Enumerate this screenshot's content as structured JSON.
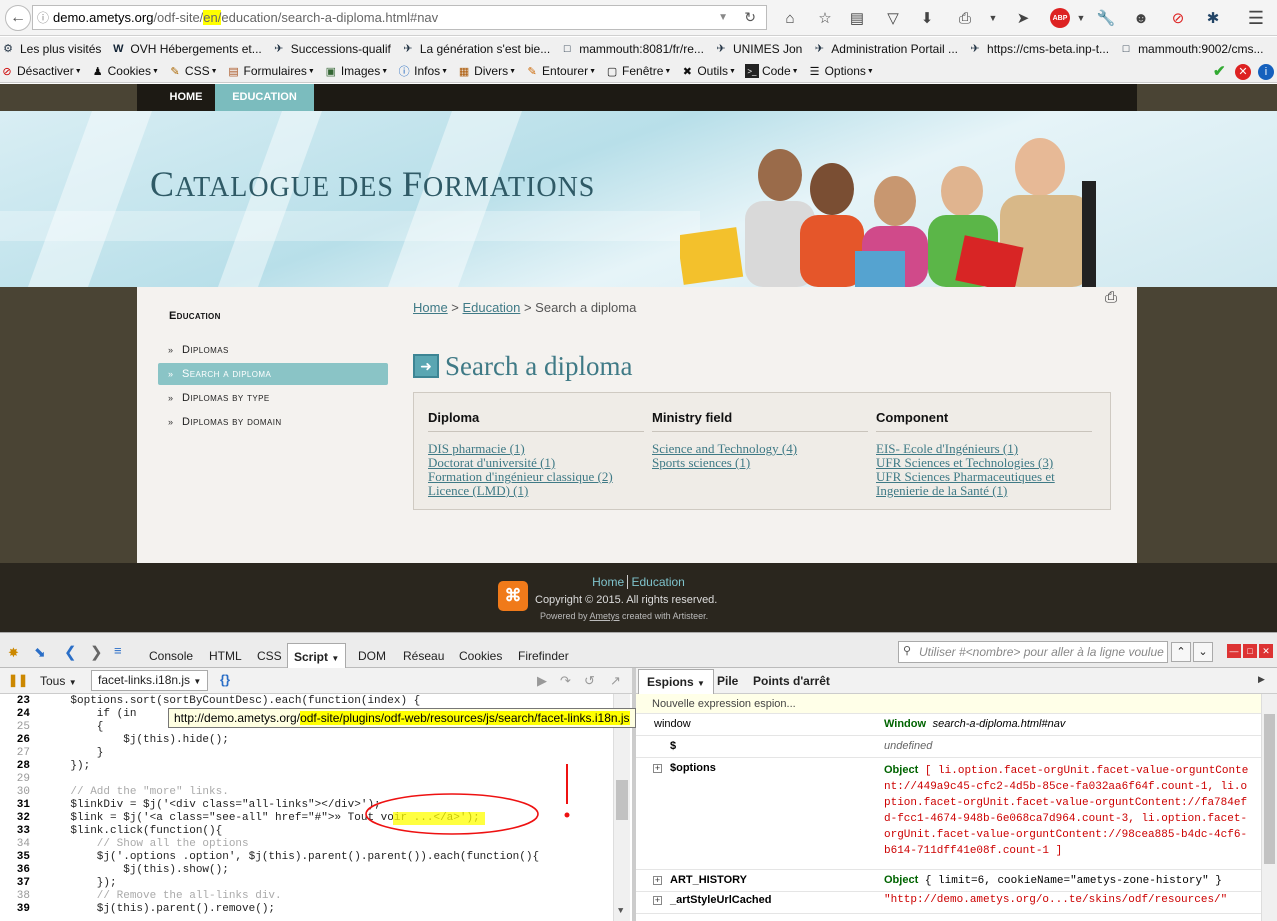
{
  "browser": {
    "url_host": "demo.ametys.org",
    "url_pre": "/odf-site/",
    "url_hl": "en/",
    "url_post": "education/search-a-diploma.html#nav"
  },
  "bookmarks": [
    {
      "label": "Les plus visités",
      "icon": "gear-icon"
    },
    {
      "label": "OVH Hébergements et...",
      "icon": "ovh-icon"
    },
    {
      "label": "Successions-qualif",
      "icon": "plane-icon"
    },
    {
      "label": "La génération s'est bie...",
      "icon": "plane-icon"
    },
    {
      "label": "mammouth:8081/fr/re...",
      "icon": "page-icon"
    },
    {
      "label": "UNIMES Jon",
      "icon": "plane-icon"
    },
    {
      "label": "Administration Portail ...",
      "icon": "plane-icon"
    },
    {
      "label": "https://cms-beta.inp-t...",
      "icon": "plane-icon"
    },
    {
      "label": "mammouth:9002/cms...",
      "icon": "page-icon"
    }
  ],
  "webdev": [
    {
      "label": "Désactiver",
      "icon": "block-icon"
    },
    {
      "label": "Cookies",
      "icon": "person-icon"
    },
    {
      "label": "CSS",
      "icon": "pencil-icon"
    },
    {
      "label": "Formulaires",
      "icon": "form-icon"
    },
    {
      "label": "Images",
      "icon": "image-icon"
    },
    {
      "label": "Infos",
      "icon": "info-icon"
    },
    {
      "label": "Divers",
      "icon": "book-icon"
    },
    {
      "label": "Entourer",
      "icon": "pencil-icon"
    },
    {
      "label": "Fenêtre",
      "icon": "window-icon"
    },
    {
      "label": "Outils",
      "icon": "tools-icon"
    },
    {
      "label": "Code",
      "icon": "code-icon"
    },
    {
      "label": "Options",
      "icon": "options-icon"
    }
  ],
  "site": {
    "nav": [
      "HOME",
      "EDUCATION"
    ],
    "title_big1": "C",
    "title_small1": "ATALOGUE DES ",
    "title_big2": "F",
    "title_small2": "ORMATIONS",
    "side_heading": "Education",
    "side_items": [
      "Diplomas",
      "Search a diploma",
      "Diplomas by type",
      "Diplomas by domain"
    ],
    "breadcrumb": {
      "home": "Home",
      "sep1": " > ",
      "education": "Education",
      "sep2": " > ",
      "current": "Search a diploma"
    },
    "page_title": "Search a diploma",
    "facets": [
      {
        "heading": "Diploma",
        "links": [
          "DIS pharmacie (1)",
          "Doctorat d'université (1)",
          "Formation d'ingénieur classique (2)",
          "Licence (LMD) (1)"
        ]
      },
      {
        "heading": "Ministry field",
        "links": [
          "Science and Technology (4)",
          "Sports sciences (1)"
        ]
      },
      {
        "heading": "Component",
        "links": [
          "EIS- Ecole d'Ingénieurs (1)",
          "UFR Sciences et Technologies (3)",
          "UFR Sciences Pharmaceutiques et",
          "Ingenierie de la Santé (1)"
        ]
      }
    ],
    "footer": {
      "nav_home": "Home",
      "nav_education": "Education",
      "copyright": "Copyright © 2015. All rights reserved.",
      "powered_pre": "Powered by ",
      "powered_link": "Ametys",
      "powered_post": " created with Artisteer."
    }
  },
  "firebug": {
    "tabs": [
      "Console",
      "HTML",
      "CSS",
      "Script",
      "DOM",
      "Réseau",
      "Cookies",
      "Firefinder"
    ],
    "active_tab": "Script",
    "search_placeholder": "Utiliser #<nombre> pour aller à la ligne voulue",
    "filter": "Tous",
    "file": "facet-links.i18n.js",
    "braces": "{}",
    "right_tabs": [
      "Espions",
      "Pile",
      "Points d'arrêt"
    ],
    "tooltip_pre": "http://demo.ametys.org/",
    "tooltip_hl": "odf-site/plugins/odf-web/resources/js/search/facet-links.i18n.js",
    "code_lines": [
      {
        "n": "23",
        "t": "    $options.sort(sortByCountDesc).each(function(index) {"
      },
      {
        "n": "24",
        "t": "        if (in"
      },
      {
        "n": "25",
        "t": "        {"
      },
      {
        "n": "26",
        "t": "            $j(this).hide();"
      },
      {
        "n": "27",
        "t": "        }"
      },
      {
        "n": "28",
        "t": "    });"
      },
      {
        "n": "29",
        "t": ""
      },
      {
        "n": "30",
        "t": "    // Add the \"more\" links."
      },
      {
        "n": "31",
        "t": "    $linkDiv = $j('<div class=\"all-links\"></div>');"
      },
      {
        "n": "32",
        "t": "    $link = $j('<a class=\"see-all\" href=\"#\">» Tout voir ...</a>');"
      },
      {
        "n": "33",
        "t": "    $link.click(function(){"
      },
      {
        "n": "34",
        "t": "        // Show all the options"
      },
      {
        "n": "35",
        "t": "        $j('.options .option', $j(this).parent().parent()).each(function(){"
      },
      {
        "n": "36",
        "t": "            $j(this).show();"
      },
      {
        "n": "37",
        "t": "        });"
      },
      {
        "n": "38",
        "t": "        // Remove the all-links div."
      },
      {
        "n": "39",
        "t": "        $j(this).parent().remove();"
      }
    ],
    "watch": {
      "new_expr": "Nouvelle expression espion...",
      "rows": [
        {
          "name": "window",
          "type": "Window",
          "val": "search-a-diploma.html#nav"
        },
        {
          "name": "$",
          "type": "",
          "val": "undefined"
        },
        {
          "name": "$options",
          "type": "Object",
          "val": "[ li.option.facet-orgUnit.facet-value-orguntContent://449a9c45-cfc2-4d5b-85ce-fa032aa6f64f.count-1, li.option.facet-orgUnit.facet-value-orguntContent://fa784efd-fcc1-4674-948b-6e068ca7d964.count-3, li.option.facet-orgUnit.facet-value-orguntContent://98cea885-b4dc-4cf6-b614-711dff41e08f.count-1 ]"
        },
        {
          "name": "ART_HISTORY",
          "type": "Object",
          "val": "{ limit=6, cookieName=\"ametys-zone-history\" }"
        },
        {
          "name": "_artStyleUrlCached",
          "type": "",
          "val": "\"http://demo.ametys.org/o...te/skins/odf/resources/\""
        }
      ]
    }
  }
}
